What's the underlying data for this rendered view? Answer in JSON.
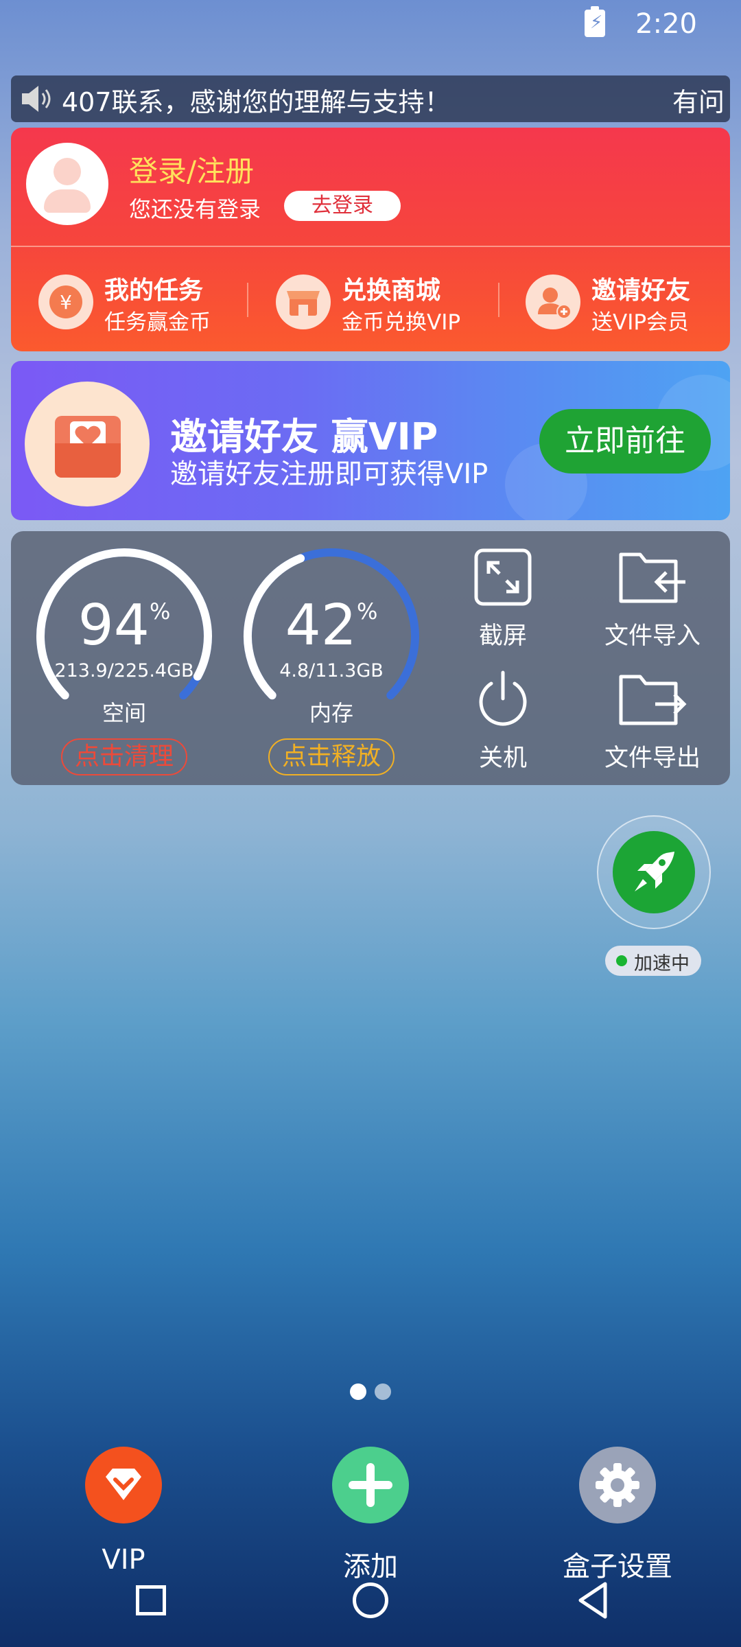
{
  "status_bar": {
    "time": "2:20",
    "battery_icon": "battery-charging-icon"
  },
  "marquee": {
    "text": "407联系，感谢您的理解与支持！",
    "tail": "有问",
    "icon": "speaker-icon"
  },
  "user_card": {
    "login_title": "登录/注册",
    "login_subtitle": "您还没有登录",
    "login_button": "去登录",
    "features": [
      {
        "title": "我的任务",
        "subtitle": "任务赢金币",
        "icon": "yen-coin-icon"
      },
      {
        "title": "兑换商城",
        "subtitle": "金币兑换VIP",
        "icon": "store-icon"
      },
      {
        "title": "邀请好友",
        "subtitle": "送VIP会员",
        "icon": "add-user-icon"
      }
    ]
  },
  "banner": {
    "title": "邀请好友 赢VIP",
    "subtitle": "邀请好友注册即可获得VIP",
    "button": "立即前往",
    "icon": "heart-envelope-icon"
  },
  "tools_panel": {
    "storage": {
      "percent": "94",
      "percent_value": 94,
      "unit": "%",
      "size": "213.9/225.4GB",
      "label": "空间",
      "action": "点击清理"
    },
    "memory": {
      "percent": "42",
      "percent_value": 42,
      "unit": "%",
      "size": "4.8/11.3GB",
      "label": "内存",
      "action": "点击释放"
    },
    "tools": [
      {
        "label": "截屏",
        "icon": "screenshot-icon"
      },
      {
        "label": "文件导入",
        "icon": "folder-import-icon"
      },
      {
        "label": "关机",
        "icon": "power-icon"
      },
      {
        "label": "文件导出",
        "icon": "folder-export-icon"
      }
    ]
  },
  "booster": {
    "status": "加速中",
    "icon": "rocket-icon"
  },
  "pager": {
    "pages": 2,
    "active": 1
  },
  "dock": [
    {
      "label": "VIP",
      "icon": "vip-diamond-icon",
      "color": "#f4511e"
    },
    {
      "label": "添加",
      "icon": "plus-icon",
      "color": "#4ccf8d"
    },
    {
      "label": "盒子设置",
      "icon": "gear-icon",
      "color": "#9aa3b8"
    }
  ],
  "nav_bar": {
    "recent": "square-icon",
    "home": "circle-icon",
    "back": "triangle-back-icon"
  },
  "colors": {
    "red": "#f5384d",
    "orange": "#fb5a2e",
    "green": "#1fa334",
    "gauge_blue": "#3b6fd9"
  }
}
